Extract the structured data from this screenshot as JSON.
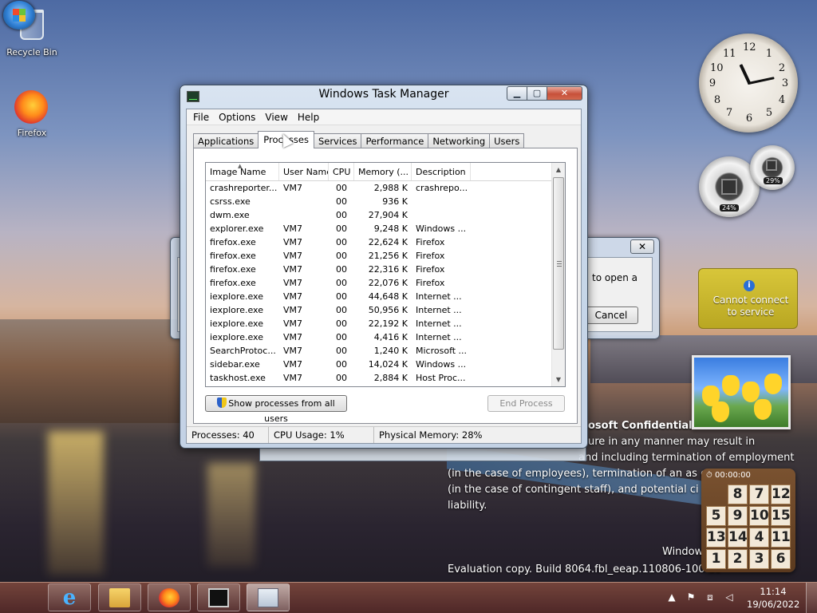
{
  "desktop": {
    "icons": [
      {
        "label": "Recycle Bin",
        "icon": "recycle-bin-icon"
      },
      {
        "label": "Firefox",
        "icon": "firefox-icon"
      }
    ],
    "watermark": {
      "title": "osoft Confidential",
      "lines": [
        "ure in any manner may result in",
        "and including termination of employment",
        "(in the case of employees), termination of an as          ct",
        "(in the case of contingent staff), and potential ci",
        "liability."
      ],
      "os_line": "Window                      ew",
      "build": "Evaluation copy. Build 8064.fbl_eeap.110806-100          d0"
    }
  },
  "gadgets": {
    "clock": {
      "numbers": [
        "12",
        "1",
        "2",
        "3",
        "4",
        "5",
        "6",
        "7",
        "8",
        "9",
        "10",
        "11"
      ],
      "time": "11:14"
    },
    "cpu_meter": {
      "cpu_percent": 24,
      "cpu_label": "24%",
      "memory_percent": 29,
      "memory_label": "29%"
    },
    "weather": {
      "message": "Cannot connect to service",
      "info_glyph": "i"
    },
    "puzzle": {
      "timer": "00:00:00",
      "tiles": [
        "",
        "8",
        "7",
        "12",
        "5",
        "9",
        "10",
        "15",
        "13",
        "14",
        "4",
        "11",
        "1",
        "2",
        "3",
        "6"
      ]
    }
  },
  "background_dialog": {
    "text": "to open a",
    "cancel_label": "Cancel",
    "close_glyph": "✕"
  },
  "task_manager": {
    "title": "Windows Task Manager",
    "window_buttons": {
      "minimize": "▁",
      "maximize": "▢",
      "close": "✕"
    },
    "menu": [
      "File",
      "Options",
      "View",
      "Help"
    ],
    "tabs": [
      "Applications",
      "Processes",
      "Services",
      "Performance",
      "Networking",
      "Users"
    ],
    "active_tab": "Processes",
    "columns": [
      "Image Name",
      "User Name",
      "CPU",
      "Memory (...",
      "Description"
    ],
    "processes": [
      {
        "image": "crashreporter...",
        "user": "VM7",
        "cpu": "00",
        "memory": "2,988 K",
        "description": "crashrepo..."
      },
      {
        "image": "csrss.exe",
        "user": "",
        "cpu": "00",
        "memory": "936 K",
        "description": ""
      },
      {
        "image": "dwm.exe",
        "user": "",
        "cpu": "00",
        "memory": "27,904 K",
        "description": ""
      },
      {
        "image": "explorer.exe",
        "user": "VM7",
        "cpu": "00",
        "memory": "9,248 K",
        "description": "Windows ..."
      },
      {
        "image": "firefox.exe",
        "user": "VM7",
        "cpu": "00",
        "memory": "22,624 K",
        "description": "Firefox"
      },
      {
        "image": "firefox.exe",
        "user": "VM7",
        "cpu": "00",
        "memory": "21,256 K",
        "description": "Firefox"
      },
      {
        "image": "firefox.exe",
        "user": "VM7",
        "cpu": "00",
        "memory": "22,316 K",
        "description": "Firefox"
      },
      {
        "image": "firefox.exe",
        "user": "VM7",
        "cpu": "00",
        "memory": "22,076 K",
        "description": "Firefox"
      },
      {
        "image": "iexplore.exe",
        "user": "VM7",
        "cpu": "00",
        "memory": "44,648 K",
        "description": "Internet ..."
      },
      {
        "image": "iexplore.exe",
        "user": "VM7",
        "cpu": "00",
        "memory": "50,956 K",
        "description": "Internet ..."
      },
      {
        "image": "iexplore.exe",
        "user": "VM7",
        "cpu": "00",
        "memory": "22,192 K",
        "description": "Internet ..."
      },
      {
        "image": "iexplore.exe",
        "user": "VM7",
        "cpu": "00",
        "memory": "4,416 K",
        "description": "Internet ..."
      },
      {
        "image": "SearchProtoc...",
        "user": "VM7",
        "cpu": "00",
        "memory": "1,240 K",
        "description": "Microsoft ..."
      },
      {
        "image": "sidebar.exe",
        "user": "VM7",
        "cpu": "00",
        "memory": "14,024 K",
        "description": "Windows ..."
      },
      {
        "image": "taskhost.exe",
        "user": "VM7",
        "cpu": "00",
        "memory": "2,884 K",
        "description": "Host Proc..."
      }
    ],
    "show_all_label": "Show processes from all users",
    "end_process_label": "End Process",
    "status": {
      "processes": "Processes: 40",
      "cpu": "CPU Usage: 1%",
      "memory": "Physical Memory: 28%"
    }
  },
  "taskbar": {
    "pinned": [
      {
        "icon": "internet-explorer-icon"
      },
      {
        "icon": "windows-explorer-icon"
      },
      {
        "icon": "firefox-icon"
      },
      {
        "icon": "command-prompt-icon"
      },
      {
        "icon": "task-manager-icon",
        "active": true
      }
    ],
    "clock_time": "11:14",
    "clock_date": "19/06/2022"
  },
  "colors": {
    "accent": "#2f7fd4",
    "close_red": "#c7503a",
    "weather_bg": "#c8b62e",
    "taskbar": "#6a3c38"
  }
}
